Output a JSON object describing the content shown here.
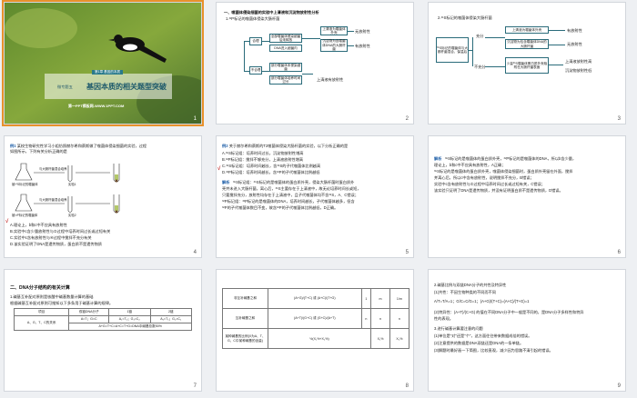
{
  "slides": [
    {
      "num": "1",
      "chapter_badge": "第1章  基因的本质",
      "title_prefix": "微专题五",
      "title": "基因本质的相关题型突破",
      "footer": "第一PPT模板网-WWW.1PPT.COM"
    },
    {
      "num": "2",
      "heading": "一、噬菌体侵染细菌的实验中上清液和沉淀物放射性分析",
      "sub": "1.³²P标记的噬菌体侵染大肠杆菌",
      "nodes": {
        "a": "合理",
        "b": "不合理",
        "c": "全部噬菌体侵染细菌后未释放",
        "d": "DNA进入细菌内",
        "e": "上清液为噬菌体外壳",
        "f": "沉淀物为含噬菌体DNA的大肠杆菌",
        "g": "部分噬菌体未侵染细菌",
        "h": "部分噬菌体培养时间过长",
        "i": "无放射性",
        "j": "有放射性",
        "k": "上清液有放射性"
      }
    },
    {
      "num": "3",
      "sub": "2.³⁵S标记的噬菌体侵染大肠杆菌",
      "left": "³⁵S标记的噬菌体与大肠杆菌混合，保温后",
      "a": "充分",
      "b": "不充分",
      "c": "上清液为噬菌体外壳",
      "d": "沉淀物为包含噬菌体DNA的大肠杆菌",
      "e": "少量³⁵S噬菌体蛋白质外壳吸附在大肠杆菌表面",
      "f": "有放射性",
      "g": "无放射性",
      "h": "上清液放射性高",
      "i": "沉淀物放射性低"
    },
    {
      "num": "4",
      "ex": "例1",
      "stem1": "某校生物研究性学习小组仿照赫尔希和蔡斯做了噬菌体侵染细菌的实验，过程",
      "stem2": "如图所示，下列有关分析正确的是",
      "lab1": "与大肠杆菌混合培养",
      "lab2": "被³⁵S标记的噬菌体",
      "lab3": "实验1",
      "lab4": "与大肠杆菌混合培养",
      "lab5": "被³²P标记的噬菌体",
      "lab6": "实验2",
      "optA": "A.理论上，b和c中不应具有放射性",
      "optB": "B.实验中c含少量放射性与②过程中培养时间过长或过短有关",
      "optC": "C.实验中c含有放射性与④过程中搅拌不充分有关",
      "optD": "D.该实验证明了DNA是遗传物质，蛋白质不是遗传物质",
      "check": "√"
    },
    {
      "num": "5",
      "ex": "例2",
      "stem1": "关于赫尔希和蔡斯的T2噬菌体侵染大肠杆菌的实验，以下分析正确的是",
      "optA": "A.³⁵S标记组：培养时间过长，沉淀物放射性增高",
      "optB": "B.³²P标记组：搅拌不够充分，上清液放射性增高",
      "optC": "C.³⁵S标记组：培养时间越长，含³⁵S的子代噬菌体比例越高",
      "optD": "D.³²P标记组：培养时间越长，含³²P的子代噬菌体比例越低",
      "check": "√",
      "ans": "解析",
      "ans1": "³⁵S标记组：³⁵S标记的是噬菌体的蛋白质外壳，侵染大肠杆菌时蛋白质外",
      "ans2": "壳并未进入大肠杆菌，离心后，³⁵S主要存在于上清液中，故无论培养时间长或短，",
      "ans3": "只要搅拌充分，放射性均存在于上清液中，且子代噬菌体均不含³⁵S，A、C错误；",
      "ans4": "³²P标记组：³²P标记的是噬菌体的DNA，培养时间越长，子代噬菌体越多，但含",
      "ans5": "³²P的子代噬菌体数目不变，故含³²P的子代噬菌体比例越低，D正确。"
    },
    {
      "num": "6",
      "ans": "解析",
      "ans1": "³⁵S标记的是噬菌体的蛋白质外壳，³²P标记的是噬菌体的DNA，所以b含少量，",
      "ans2": "理论上，b和c中不应具有放射性，A正确；",
      "ans3": "³⁵S标记的是噬菌体的蛋白质外壳，噬菌体侵染细菌时，蛋白质外壳留在外面，搅拌",
      "ans4": "并离心后，所以c中含有放射性，说明搅拌不充分，B错误；",
      "ans5": "实验中c含有放射性与②过程中培养时间过长或过短有关，C错误；",
      "ans6": "该实验只证明了DNA是遗传物质，并没有证明蛋白质不是遗传物质，D错误。"
    },
    {
      "num": "7",
      "heading": "二、DNA分子结构的有关计算",
      "l1": "1.碱基互补配对原则是核酸中碱基数量计算的基础",
      "l2": "根据碱基互补配对原则可推知以下多条用于碱基计算的规律。",
      "th1": "项目",
      "th2": "双链DNA分子",
      "th3": "1链",
      "th4": "2链",
      "r1c1": "A、G、T、C的关系",
      "r1c3": "A₁=T₂；G₁=C₂",
      "r1c4": "A₂=T₁；G₂=C₁",
      "r2": "A=T；G=C",
      "r3": "A+G=T+C=A+C=T+G=DNA中碱基总数50%"
    },
    {
      "num": "8",
      "r1a": "非互补碱基之和",
      "r1b": "(A+G)/(T+C) 或 (A+C)/(T+G)",
      "r1c": "1",
      "r1d": "m",
      "r1e": "1/m",
      "r2a": "互补碱基之和",
      "r2b": "(A+T)/(G+C) 或 (G+C)/(A+T)",
      "r2c": "n",
      "r2d": "n",
      "r2e": "n",
      "r3a": "某种碱基的比例(X为A、T、G、C中某种碱基的含量)",
      "r3b": "½(X₁%+X₂%)",
      "r3c": "X₁%",
      "r3d": "X₂%"
    },
    {
      "num": "9",
      "l1": "2.碱基比例与双链DNA分子的共性及特异性",
      "l2": "(1)共性：不因生物种类的不同而不同",
      "l3": "A/T=T/A=1；G/C=C/G=1；(A+G)/(T+C)=(A+C)/(T+G)=1",
      "l4": "(2)特异性：(A+T)/(C+G) 的值在不同DNA分子中一般是不同的，是DNA分子多样性和特异",
      "l5": "性的表现。",
      "l6": "3.进行碱基计算要注意的问题",
      "l7": "(1)单位是\"对\"还是\"个\"，这方面往往带来数据成倍的错误。",
      "l8": "(2)注意提供的数据是DNA双链还是DNA的一条单链。",
      "l9": "(3)解题时最好画一下简图，比较直观，减少因为思路不清引起的错误。"
    }
  ],
  "colors": {
    "accent": "#2a7a8c",
    "selection": "#e8912b",
    "red": "#c02020"
  }
}
